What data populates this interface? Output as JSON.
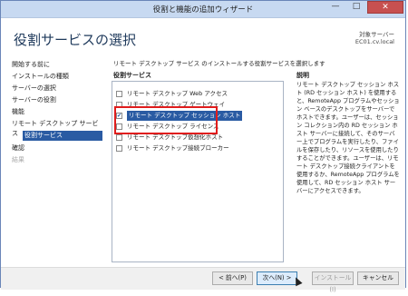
{
  "window": {
    "title": "役割と機能の追加ウィザード",
    "controls": {
      "minimize": "—",
      "maximize": "□",
      "close": "✕"
    }
  },
  "header": {
    "page_title": "役割サービスの選択",
    "server_label": "対象サーバー",
    "server_name": "EC01.cv.local"
  },
  "sidebar": {
    "items": [
      {
        "label": "開始する前に",
        "state": "normal"
      },
      {
        "label": "インストールの種類",
        "state": "normal"
      },
      {
        "label": "サーバーの選択",
        "state": "normal"
      },
      {
        "label": "サーバーの役割",
        "state": "normal"
      },
      {
        "label": "機能",
        "state": "normal"
      },
      {
        "label": "リモート デスクトップ サービス",
        "state": "normal"
      },
      {
        "label": "役割サービス",
        "state": "active"
      },
      {
        "label": "確認",
        "state": "normal"
      },
      {
        "label": "結果",
        "state": "disabled"
      }
    ]
  },
  "main": {
    "instruction": "リモート デスクトップ サービス のインストールする役割サービスを選択します",
    "role_services_header": "役割サービス",
    "description_header": "説明",
    "role_services": [
      {
        "label": "リモート デスクトップ Web アクセス",
        "checked": false,
        "selected": false
      },
      {
        "label": "リモート デスクトップ ゲートウェイ",
        "checked": false,
        "selected": false
      },
      {
        "label": "リモート デスクトップ セッション ホスト",
        "checked": true,
        "selected": true
      },
      {
        "label": "リモート デスクトップ ライセンス",
        "checked": false,
        "selected": false
      },
      {
        "label": "リモート デスクトップ仮想化ホスト",
        "checked": false,
        "selected": false
      },
      {
        "label": "リモート デスクトップ接続ブローカー",
        "checked": false,
        "selected": false
      }
    ],
    "description": "リモート デスクトップ セッション ホスト (RD セッション ホスト) を使用すると、RemoteApp プログラムやセッション ベースのデスクトップをサーバーでホストできます。ユーザーは、セッション コレクション内の RD セッション ホスト サーバーに接続して、そのサーバー上でプログラムを実行したり、ファイルを保存したり、リソースを使用したりすることができます。ユーザーは、リモート デスクトップ接続クライアントを使用するか、RemoteApp プログラムを使用して、RD セッション ホスト サーバーにアクセスできます。"
  },
  "footer": {
    "back_label": "< 前へ(P)",
    "next_label": "次へ(N) >",
    "install_label": "インストール(I)",
    "cancel_label": "キャンセル"
  },
  "colors": {
    "title_bar": "#c7d9f1",
    "accent": "#2a5ba3",
    "highlight_outline": "#e01c1c",
    "close_button": "#c75050"
  }
}
